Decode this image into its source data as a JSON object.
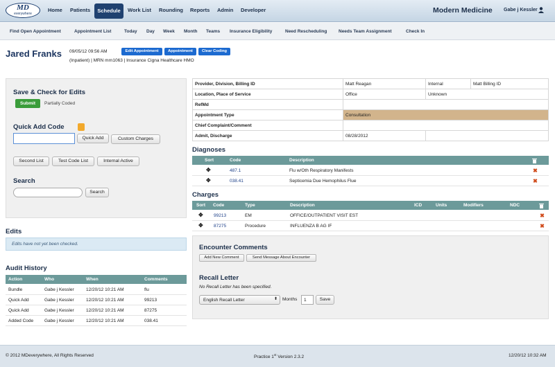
{
  "brand": {
    "logo_top": "MD",
    "logo_bottom": "everywhere",
    "practice": "Modern Medicine",
    "user": "Gabe j Kessler"
  },
  "nav": {
    "home": "Home",
    "patients": "Patients",
    "schedule": "Schedule",
    "worklist": "Work List",
    "rounding": "Rounding",
    "reports": "Reports",
    "admin": "Admin",
    "developer": "Developer"
  },
  "subnav": [
    "Find Open Appointment",
    "Appointment List",
    "Today",
    "Day",
    "Week",
    "Month",
    "Teams",
    "Insurance Eligibility",
    "Need Rescheduling",
    "Needs Team Assignment",
    "Check In"
  ],
  "patient": {
    "name": "Jared Franks",
    "datetime": "09/05/12 09:56 AM",
    "info": "(Inpatient) | MRN mrn1063 | Insurance Cigna Healthcare HMO",
    "btn_edit": "Edit Appointment",
    "btn_appt": "Appointment",
    "btn_clear": "Clear Coding"
  },
  "save_check": {
    "title": "Save & Check for Edits",
    "submit": "Submit",
    "status": "Partially Coded"
  },
  "quick_add": {
    "title": "Quick Add Code",
    "value": "",
    "btn_add": "Quick Add",
    "btn_custom": "Custom Charges",
    "btn_second": "Second List",
    "btn_test": "Test Code List",
    "btn_internal": "Internal Active"
  },
  "search": {
    "title": "Search",
    "value": "",
    "btn": "Search"
  },
  "edits": {
    "title": "Edits",
    "message": "Edits have not yet been checked."
  },
  "audit": {
    "title": "Audit History",
    "headers": [
      "Action",
      "Who",
      "When",
      "Comments"
    ],
    "rows": [
      [
        "Bundle",
        "Gabe j Kessler",
        "12/20/12 10:21 AM",
        "flu"
      ],
      [
        "Quick Add",
        "Gabe j Kessler",
        "12/20/12 10:21 AM",
        "99213"
      ],
      [
        "Quick Add",
        "Gabe j Kessler",
        "12/20/12 10:21 AM",
        "87275"
      ],
      [
        "Added Code",
        "Gabe j Kessler",
        "12/20/12 10:21 AM",
        "038.41"
      ]
    ]
  },
  "info": {
    "provider_label": "Provider, Division, Billing ID",
    "provider": "Matt Reagan",
    "division": "Internal",
    "billing": "Matt Billing ID",
    "location_label": "Location, Place of Service",
    "location": "Office",
    "pos": "Unknown",
    "refmd_label": "RefMd",
    "appt_type_label": "Appointment Type",
    "appt_type": "Consultation",
    "chief_label": "Chief Complaint/Comment",
    "admit_label": "Admit, Discharge",
    "admit": "08/28/2012"
  },
  "diagnoses": {
    "title": "Diagnoses",
    "headers": [
      "Sort",
      "Code",
      "Description"
    ],
    "rows": [
      [
        "487.1",
        "Flu w/Oth Respiratory Manifests"
      ],
      [
        "038.41",
        "Septicemia Due Hemophilus Flue"
      ]
    ]
  },
  "charges": {
    "title": "Charges",
    "headers": [
      "Sort",
      "Code",
      "Type",
      "Description",
      "ICD",
      "Units",
      "Modifiers",
      "NDC"
    ],
    "rows": [
      [
        "99213",
        "EM",
        "OFFICE/OUTPATIENT VISIT EST"
      ],
      [
        "87275",
        "Procedure",
        "INFLUENZA B AG IF"
      ]
    ]
  },
  "encounter": {
    "title": "Encounter Comments",
    "btn_add": "Add New Comment",
    "btn_send": "Send Message About Encounter"
  },
  "recall": {
    "title": "Recall Letter",
    "message": "No Recall Letter has been specified.",
    "letter": "English Recall Letter",
    "months_label": "Months",
    "months_value": "1",
    "btn_save": "Save"
  },
  "footer": {
    "copyright": "© 2012 MDeverywhere, All Rights Reserved",
    "version_pre": "Practice 1",
    "version_sup": "st",
    "version_post": " Version 2.3.2",
    "datetime": "12/20/12 10:32 AM"
  }
}
